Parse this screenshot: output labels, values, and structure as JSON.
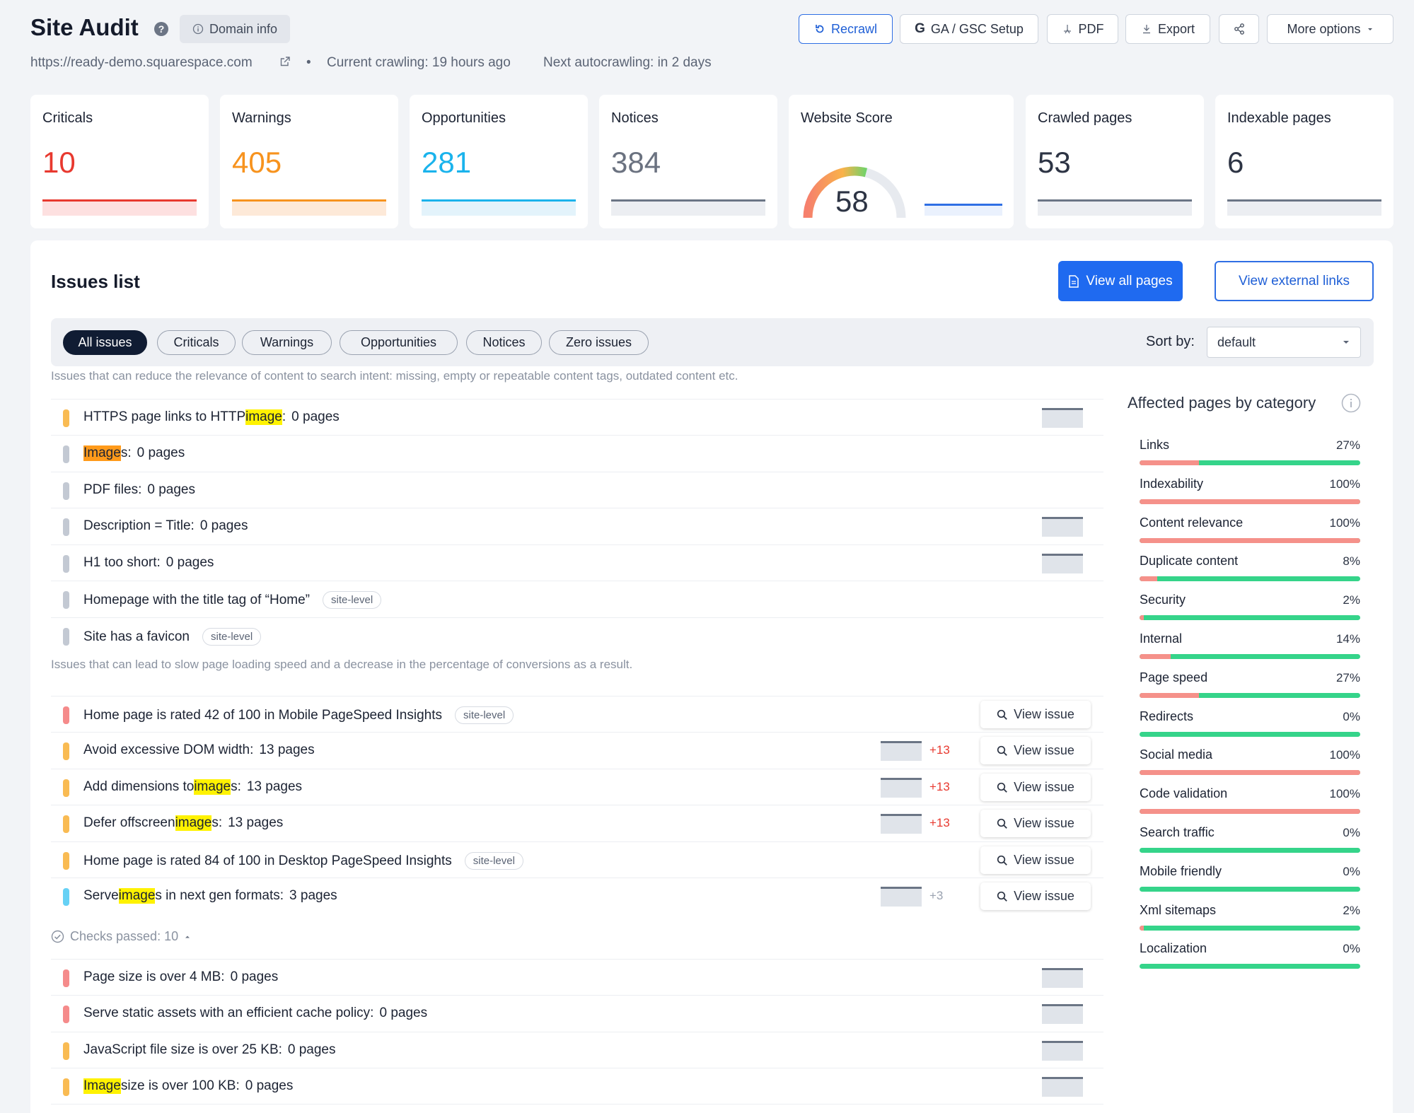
{
  "header": {
    "title": "Site Audit",
    "help": "?",
    "domain_info": "Domain info",
    "url": "https://ready-demo.squarespace.com",
    "bullet": "•",
    "current_crawling": "Current crawling: 19 hours ago",
    "next_autocrawling": "Next autocrawling: in 2 days",
    "buttons": {
      "recrawl": "Recrawl",
      "ga_gsc": "GA / GSC Setup",
      "pdf": "PDF",
      "export": "Export",
      "more": "More options"
    }
  },
  "stats": [
    {
      "label": "Criticals",
      "value": "10",
      "color": "#e8392f",
      "fill": "#fde0e0"
    },
    {
      "label": "Warnings",
      "value": "405",
      "color": "#f7931e",
      "fill": "#fde9d8"
    },
    {
      "label": "Opportunities",
      "value": "281",
      "color": "#1ab3ec",
      "fill": "#e3f3fb"
    },
    {
      "label": "Notices",
      "value": "384",
      "color": "#6b7280",
      "fill": "#eceef2"
    },
    {
      "label": "Website Score",
      "value": "58",
      "color": "#2d3444",
      "fill": ""
    },
    {
      "label": "Crawled pages",
      "value": "53",
      "color": "#2d3444",
      "fill": "#eceef2"
    },
    {
      "label": "Indexable pages",
      "value": "6",
      "color": "#2d3444",
      "fill": "#eceef2"
    }
  ],
  "issues": {
    "title": "Issues list",
    "view_all": "View all pages",
    "view_external": "View external links",
    "filters": [
      "All issues",
      "Criticals",
      "Warnings",
      "Opportunities",
      "Notices",
      "Zero issues"
    ],
    "sort_label": "Sort by:",
    "sort_value": "default",
    "desc_content": "Issues that can reduce the relevance of content to search intent: missing, empty or repeatable content tags, outdated content etc.",
    "desc_speed": "Issues that can lead to slow page loading speed and a decrease in the percentage of conversions as a result.",
    "view_issue": "View issue",
    "checks_passed": "Checks passed: 10",
    "rows": [
      {
        "pre": "HTTPS page links to HTTP ",
        "hl": "image",
        "post": ":",
        "count": "0 pages",
        "tag": "",
        "color": "#f9bb53",
        "spark": true,
        "delta": "",
        "view": false
      },
      {
        "pre": "",
        "hl": "Image",
        "post": "s:",
        "count": "0 pages",
        "tag": "",
        "color": "#c3c9d3",
        "spark": false,
        "delta": "",
        "view": false
      },
      {
        "pre": "PDF files:",
        "hl": "",
        "post": "",
        "count": "0 pages",
        "tag": "",
        "color": "#c3c9d3",
        "spark": false,
        "delta": "",
        "view": false
      },
      {
        "pre": "Description = Title:",
        "hl": "",
        "post": "",
        "count": "0 pages",
        "tag": "",
        "color": "#c3c9d3",
        "spark": true,
        "delta": "",
        "view": false
      },
      {
        "pre": "H1 too short:",
        "hl": "",
        "post": "",
        "count": "0 pages",
        "tag": "",
        "color": "#c3c9d3",
        "spark": true,
        "delta": "",
        "view": false
      },
      {
        "pre": "Homepage with the title tag of “Home”",
        "hl": "",
        "post": "",
        "count": "",
        "tag": "site-level",
        "color": "#c3c9d3",
        "spark": false,
        "delta": "",
        "view": false
      },
      {
        "pre": "Site has a favicon",
        "hl": "",
        "post": "",
        "count": "",
        "tag": "site-level",
        "color": "#c3c9d3",
        "spark": false,
        "delta": "",
        "view": false
      },
      {
        "pre": "Home page is rated 42 of 100 in Mobile PageSpeed Insights",
        "hl": "",
        "post": "",
        "count": "",
        "tag": "site-level",
        "color": "#f58b8b",
        "spark": false,
        "delta": "",
        "view": true
      },
      {
        "pre": "Avoid excessive DOM width:",
        "hl": "",
        "post": "",
        "count": "13 pages",
        "tag": "",
        "color": "#f9bb53",
        "spark": true,
        "delta": "+13",
        "view": true
      },
      {
        "pre": "Add dimensions to ",
        "hl": "image",
        "post": "s:",
        "count": "13 pages",
        "tag": "",
        "color": "#f9bb53",
        "spark": true,
        "delta": "+13",
        "view": true
      },
      {
        "pre": "Defer offscreen ",
        "hl": "image",
        "post": "s:",
        "count": "13 pages",
        "tag": "",
        "color": "#f9bb53",
        "spark": true,
        "delta": "+13",
        "view": true
      },
      {
        "pre": "Home page is rated 84 of 100 in Desktop PageSpeed Insights",
        "hl": "",
        "post": "",
        "count": "",
        "tag": "site-level",
        "color": "#f9bb53",
        "spark": false,
        "delta": "",
        "view": true
      },
      {
        "pre": "Serve ",
        "hl": "image",
        "post": "s in next gen formats:",
        "count": "3 pages",
        "tag": "",
        "color": "#66d1f5",
        "spark": true,
        "delta": "+3",
        "view": true
      },
      {
        "pre": "Page size is over 4 MB:",
        "hl": "",
        "post": "",
        "count": "0 pages",
        "tag": "",
        "color": "#f58b8b",
        "spark": true,
        "delta": "",
        "view": false
      },
      {
        "pre": "Serve static assets with an efficient cache policy:",
        "hl": "",
        "post": "",
        "count": "0 pages",
        "tag": "",
        "color": "#f58b8b",
        "spark": true,
        "delta": "",
        "view": false
      },
      {
        "pre": "JavaScript file size is over 25 KB:",
        "hl": "",
        "post": "",
        "count": "0 pages",
        "tag": "",
        "color": "#f9bb53",
        "spark": true,
        "delta": "",
        "view": false
      },
      {
        "pre": "",
        "hl": "Image",
        "post": " size is over 100 KB:",
        "count": "0 pages",
        "tag": "",
        "color": "#f9bb53",
        "spark": true,
        "delta": "",
        "view": false
      }
    ]
  },
  "affected": {
    "title": "Affected pages by category",
    "categories": [
      {
        "label": "Links",
        "pct": "27%",
        "value": 27
      },
      {
        "label": "Indexability",
        "pct": "100%",
        "value": 100
      },
      {
        "label": "Content relevance",
        "pct": "100%",
        "value": 100
      },
      {
        "label": "Duplicate content",
        "pct": "8%",
        "value": 8
      },
      {
        "label": "Security",
        "pct": "2%",
        "value": 2
      },
      {
        "label": "Internal",
        "pct": "14%",
        "value": 14
      },
      {
        "label": "Page speed",
        "pct": "27%",
        "value": 27
      },
      {
        "label": "Redirects",
        "pct": "0%",
        "value": 0
      },
      {
        "label": "Social media",
        "pct": "100%",
        "value": 100
      },
      {
        "label": "Code validation",
        "pct": "100%",
        "value": 100
      },
      {
        "label": "Search traffic",
        "pct": "0%",
        "value": 0
      },
      {
        "label": "Mobile friendly",
        "pct": "0%",
        "value": 0
      },
      {
        "label": "Xml sitemaps",
        "pct": "2%",
        "value": 2
      },
      {
        "label": "Localization",
        "pct": "0%",
        "value": 0
      }
    ]
  },
  "colors": {
    "accent": "#1f6af0",
    "critical": "#e8392f",
    "warning": "#f7931e",
    "opportunity": "#1ab3ec",
    "positive": "#35d48a",
    "negative": "#f5918a"
  }
}
